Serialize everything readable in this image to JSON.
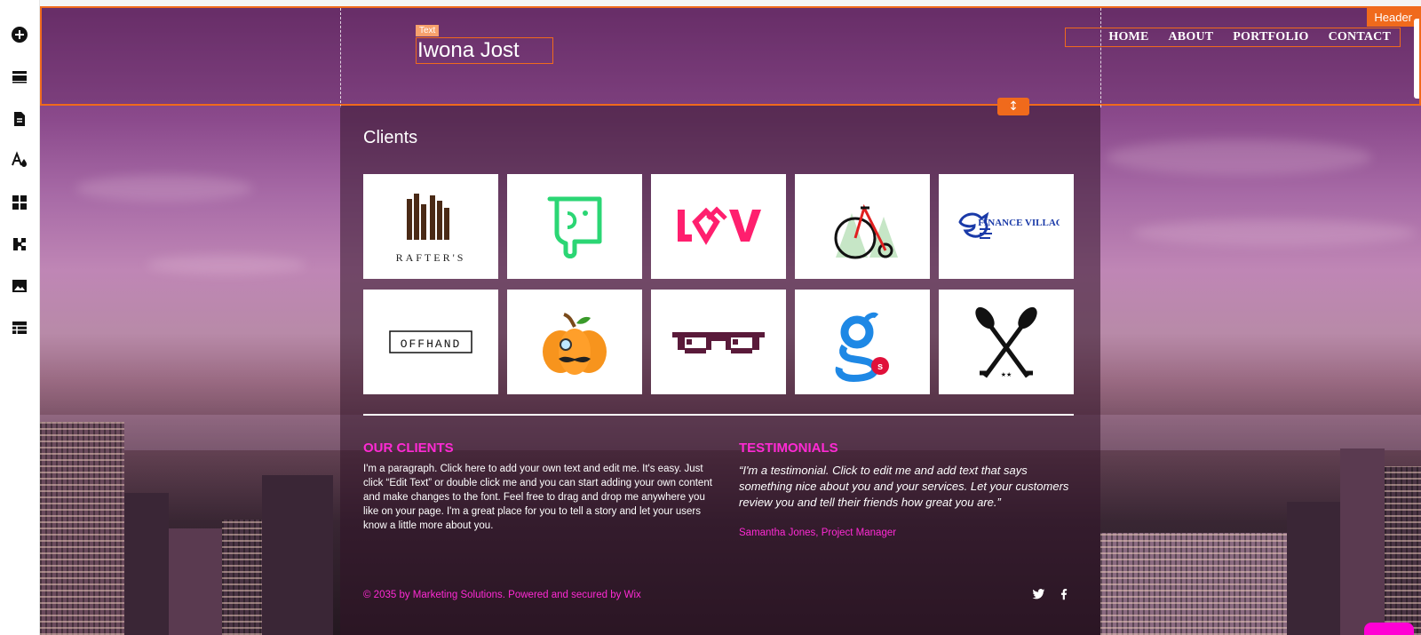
{
  "toolbar": {
    "tools": [
      "add-icon",
      "sections-icon",
      "pages-icon",
      "theme-icon",
      "apps-icon",
      "extensions-icon",
      "media-icon",
      "table-icon"
    ]
  },
  "header": {
    "badge": "Header",
    "text_tag": "Text",
    "site_title": "Iwona Jost",
    "nav": [
      "HOME",
      "ABOUT",
      "PORTFOLIO",
      "CONTACT"
    ],
    "resize_glyph": "↕"
  },
  "clients": {
    "title": "Clients",
    "logos": [
      "RAFTER'S",
      "elephant-logo",
      "LV-logo",
      "bicycle-logo",
      "FINANCE VILLAGE",
      "OFFHAND",
      "pumpkin-logo",
      "glasses-logo",
      "g-logo",
      "oars-logo"
    ]
  },
  "our_clients": {
    "title": "OUR CLIENTS",
    "text": "I'm a paragraph. Click here to add your own text and edit me. It's easy. Just click “Edit Text” or double click me and you can start adding your own content and make changes to the font. Feel free to drag and drop me anywhere you like on your page. I'm a great place for you to tell a story and let your users know a little more about you."
  },
  "testimonials": {
    "title": "TESTIMONIALS",
    "quote": "“I'm a testimonial. Click to edit me and add text that says something nice about you and your services. Let your customers review you and tell their friends how great you are.”",
    "author": "Samantha Jones, Project Manager"
  },
  "footer": {
    "text": "© 2035 by Marketing Solutions. Powered and secured by Wix",
    "social": [
      "twitter-icon",
      "facebook-icon"
    ]
  },
  "colors": {
    "accent": "#f06a1c",
    "pink": "#ff2ad4"
  }
}
